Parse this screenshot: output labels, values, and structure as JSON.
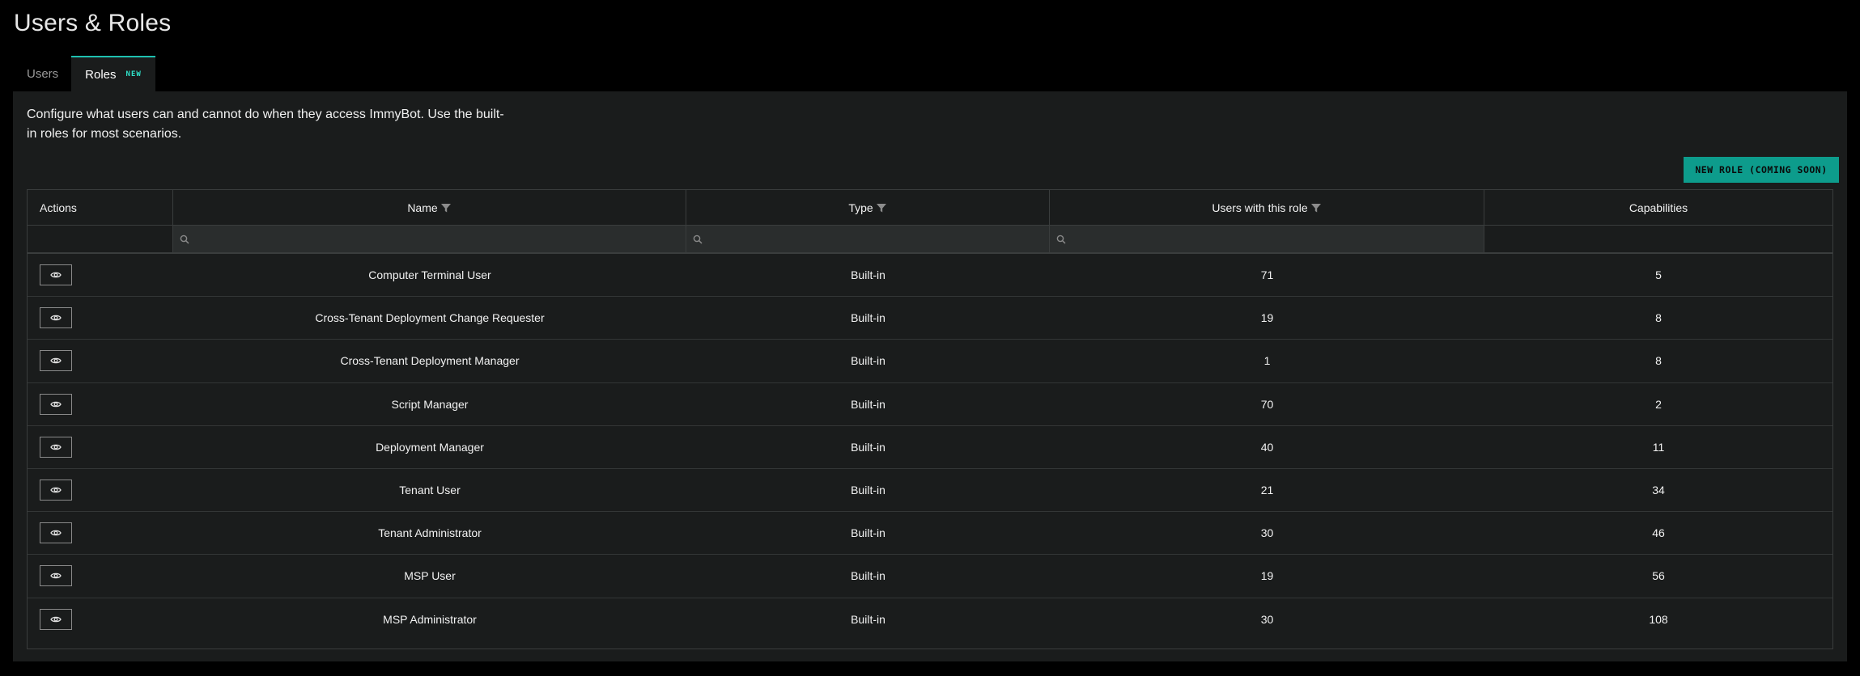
{
  "page": {
    "title": "Users & Roles"
  },
  "tabs": [
    {
      "label": "Users",
      "active": false
    },
    {
      "label": "Roles",
      "active": true,
      "badge": "NEW"
    }
  ],
  "description": "Configure what users can and cannot do when they access ImmyBot. Use the built-in roles for most scenarios.",
  "new_role_button": "NEW ROLE (COMING SOON)",
  "colors": {
    "accent": "#0d9c8c",
    "badge": "#2fe0c8",
    "panel": "#1a1c1c",
    "background": "#000000"
  },
  "table": {
    "columns": [
      "Actions",
      "Name",
      "Type",
      "Users with this role",
      "Capabilities"
    ],
    "filterable": [
      "Name",
      "Type",
      "Users with this role"
    ],
    "filter_placeholders": [
      "",
      "",
      ""
    ],
    "rows": [
      {
        "name": "Computer Terminal User",
        "type": "Built-in",
        "users": "71",
        "capabilities": "5"
      },
      {
        "name": "Cross-Tenant Deployment Change Requester",
        "type": "Built-in",
        "users": "19",
        "capabilities": "8"
      },
      {
        "name": "Cross-Tenant Deployment Manager",
        "type": "Built-in",
        "users": "1",
        "capabilities": "8"
      },
      {
        "name": "Script Manager",
        "type": "Built-in",
        "users": "70",
        "capabilities": "2"
      },
      {
        "name": "Deployment Manager",
        "type": "Built-in",
        "users": "40",
        "capabilities": "11"
      },
      {
        "name": "Tenant User",
        "type": "Built-in",
        "users": "21",
        "capabilities": "34"
      },
      {
        "name": "Tenant Administrator",
        "type": "Built-in",
        "users": "30",
        "capabilities": "46"
      },
      {
        "name": "MSP User",
        "type": "Built-in",
        "users": "19",
        "capabilities": "56"
      },
      {
        "name": "MSP Administrator",
        "type": "Built-in",
        "users": "30",
        "capabilities": "108"
      }
    ],
    "icons": {
      "row_action": "eye-icon",
      "header_filter": "filter-icon",
      "search": "search-icon"
    }
  }
}
